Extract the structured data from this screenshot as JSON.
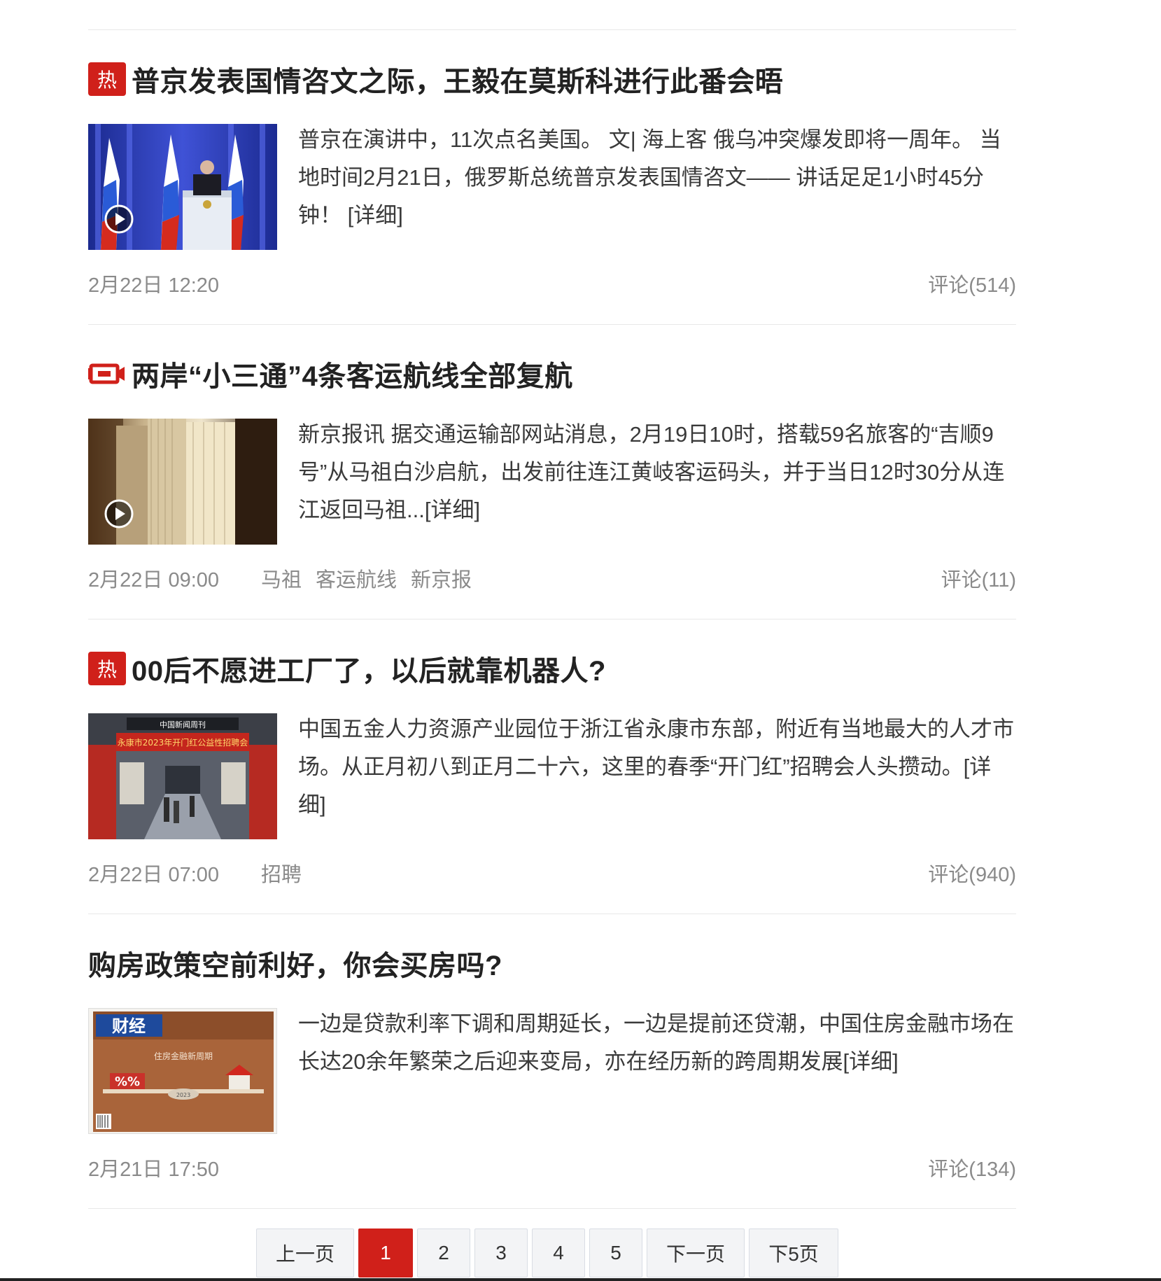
{
  "articles": [
    {
      "badge": "热",
      "badge_icon": "hot-badge-icon",
      "title": "普京发表国情咨文之际，王毅在莫斯科进行此番会晤",
      "summary": "普京在演讲中，11次点名美国。 文| 海上客 俄乌冲突爆发即将一周年。 当地时间2月21日，俄罗斯总统普京发表国情咨文—— 讲话足足1小时45分钟！ [详细]",
      "date": "2月22日 12:20",
      "tags": [],
      "comments": "评论(514)",
      "has_video": true
    },
    {
      "badge": "",
      "badge_icon": "video-camera-icon",
      "title": "两岸“小三通”4条客运航线全部复航",
      "summary": "新京报讯 据交通运输部网站消息，2月19日10时，搭载59名旅客的“吉顺9号”从马祖白沙启航，出发前往连江黄岐客运码头，并于当日12时30分从连江返回马祖...[详细]",
      "date": "2月22日 09:00",
      "tags": [
        "马祖",
        "客运航线",
        "新京报"
      ],
      "comments": "评论(11)",
      "has_video": true
    },
    {
      "badge": "热",
      "badge_icon": "hot-badge-icon",
      "title": "00后不愿进工厂了，以后就靠机器人?",
      "summary": "中国五金人力资源产业园位于浙江省永康市东部，附近有当地最大的人才市场。从正月初八到正月二十六，这里的春季“开门红”招聘会人头攒动。[详细]",
      "date": "2月22日 07:00",
      "tags": [
        "招聘"
      ],
      "comments": "评论(940)",
      "has_video": false
    },
    {
      "badge": "",
      "badge_icon": "",
      "title": "购房政策空前利好，你会买房吗?",
      "summary": "一边是贷款利率下调和周期延长，一边是提前还贷潮，中国住房金融市场在长达20余年繁荣之后迎来变局，亦在经历新的跨周期发展[详细]",
      "date": "2月21日 17:50",
      "tags": [],
      "comments": "评论(134)",
      "has_video": false
    }
  ],
  "thumb_text": {
    "factory_banner_top": "中国新闻周刊",
    "factory_banner": "永康市2023年开门红公益性招聘会",
    "magazine_logo": "财经",
    "magazine_headline": "住房金融新周期",
    "magazine_percent": "%%",
    "magazine_year": "2023"
  },
  "pagination": {
    "prev": "上一页",
    "pages": [
      "1",
      "2",
      "3",
      "4",
      "5"
    ],
    "active": "1",
    "next": "下一页",
    "next5": "下5页"
  },
  "colors": {
    "accent": "#d0201a",
    "meta": "#8a8a8a",
    "title": "#222222"
  }
}
